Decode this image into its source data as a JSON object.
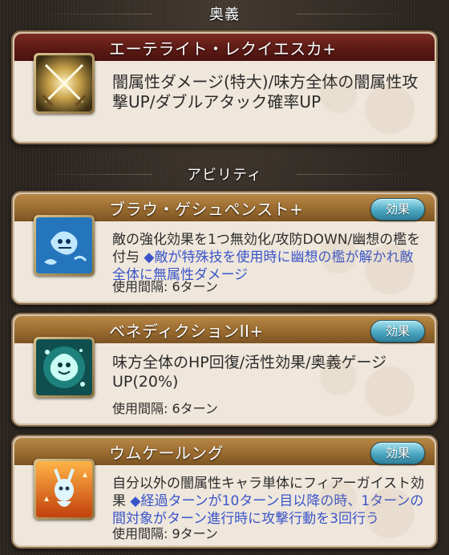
{
  "sections": {
    "ougi_header": "奥義",
    "ability_header": "アビリティ"
  },
  "ougi": {
    "title": "エーテライト・レクイエスカ+",
    "description": "闇属性ダメージ(特大)/味方全体の闇属性攻撃UP/ダブルアタック確率UP",
    "icon": "crossed-swords-icon"
  },
  "abilities": [
    {
      "title": "ブラウ・ゲシュペンスト+",
      "description": "敵の強化効果を1つ無効化/攻防DOWN/幽想の檻を付与",
      "note": "◆敵が特殊技を使用時に幽想の檻が解かれ敵全体に無属性ダメージ",
      "cooldown": "使用間隔: 6ターン",
      "effect_label": "効果",
      "icon": "ghost-debuff-icon"
    },
    {
      "title": "ベネディクションII+",
      "description": "味方全体のHP回復/活性効果/奥義ゲージUP(20%)",
      "note": "",
      "cooldown": "使用間隔: 6ターン",
      "effect_label": "効果",
      "icon": "ghost-heal-icon"
    },
    {
      "title": "ウムケールング",
      "description": "自分以外の闇属性キャラ単体にフィアーガイスト効果",
      "note": "◆経過ターンが10ターン目以降の時、1ターンの間対象がターン進行時に攻撃行動を3回行う",
      "cooldown": "使用間隔: 9ターン",
      "effect_label": "効果",
      "icon": "spirit-buff-icon"
    }
  ],
  "colors": {
    "ougi_title_bg": "#5a1914",
    "ability_title_bg": "#9a6b2f",
    "note_text": "#3a55c9",
    "effect_button": "#4aa7c2"
  }
}
